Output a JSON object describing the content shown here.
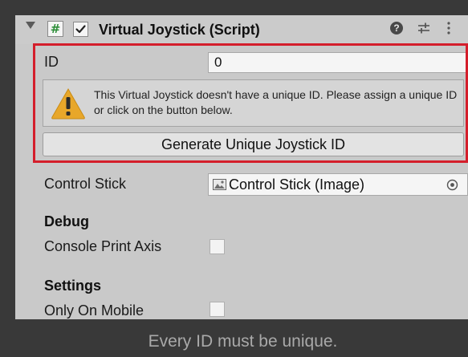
{
  "component": {
    "title": "Virtual Joystick (Script)",
    "script_icon_glyph": "#",
    "enabled": true
  },
  "fields": {
    "id_label": "ID",
    "id_value": "0",
    "warning_text": "This Virtual Joystick doesn't have a unique ID. Please assign a unique ID or click on the button below.",
    "generate_button_label": "Generate Unique Joystick ID",
    "control_stick_label": "Control Stick",
    "control_stick_value": "Control Stick (Image)"
  },
  "debug": {
    "header": "Debug",
    "console_print_axis_label": "Console Print Axis",
    "console_print_axis_checked": false
  },
  "settings": {
    "header": "Settings",
    "only_on_mobile_label": "Only On Mobile",
    "only_on_mobile_checked": false
  },
  "caption": "Every ID must be unique.",
  "icons": {
    "foldout": "foldout-arrow-icon",
    "script": "script-icon",
    "help": "help-icon",
    "preset": "preset-icon",
    "menu": "kebab-menu-icon",
    "warning": "warning-icon",
    "image": "image-icon",
    "picker": "object-picker-icon"
  },
  "colors": {
    "page_background": "#393939",
    "inspector_background": "#c9c9c9",
    "highlight_outline": "#d41e2b",
    "warning_yellow": "#e8a72a",
    "caption_text": "#a9a9a9"
  }
}
